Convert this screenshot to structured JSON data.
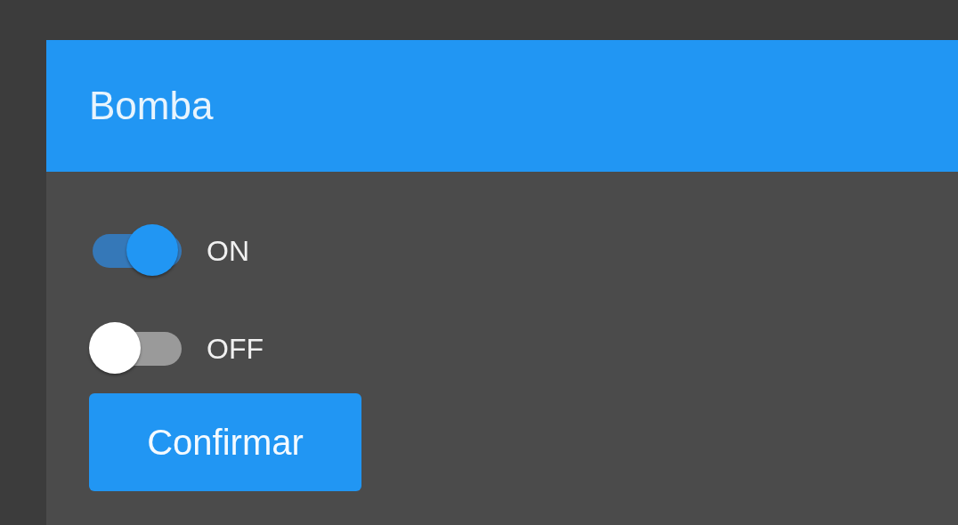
{
  "card": {
    "title": "Bomba"
  },
  "switches": [
    {
      "label": "ON",
      "on": true
    },
    {
      "label": "OFF",
      "on": false
    }
  ],
  "button": {
    "label": "Confirmar"
  }
}
